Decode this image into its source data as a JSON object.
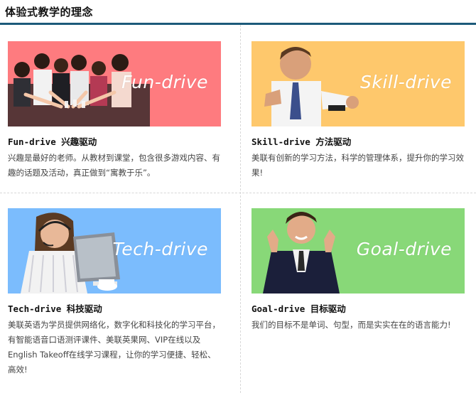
{
  "header": {
    "title": "体验式教学的理念"
  },
  "cards": [
    {
      "banner_text": "Fun-drive",
      "banner_color": "#fe7b7f",
      "title": "Fun-drive 兴趣驱动",
      "description": "兴趣是最好的老师。从教材到课堂，包含很多游戏内容、有趣的话题及活动，真正做到“寓教于乐”。"
    },
    {
      "banner_text": "Skill-drive",
      "banner_color": "#fec86c",
      "title": "Skill-drive 方法驱动",
      "description": "美联有创新的学习方法，科学的管理体系，提升你的学习效果!"
    },
    {
      "banner_text": "Tech-drive",
      "banner_color": "#7bbcfd",
      "title": "Tech-drive 科技驱动",
      "description": "美联英语为学员提供网络化，数字化和科技化的学习平台， 有智能语音口语测评课件、美联英果网、VIP在线以及 English Takeoff在线学习课程，让你的学习便捷、轻松、 高效!"
    },
    {
      "banner_text": "Goal-drive",
      "banner_color": "#88d878",
      "title": "Goal-drive 目标驱动",
      "description": "我们的目标不是单词、句型，而是实实在在的语言能力!"
    }
  ]
}
